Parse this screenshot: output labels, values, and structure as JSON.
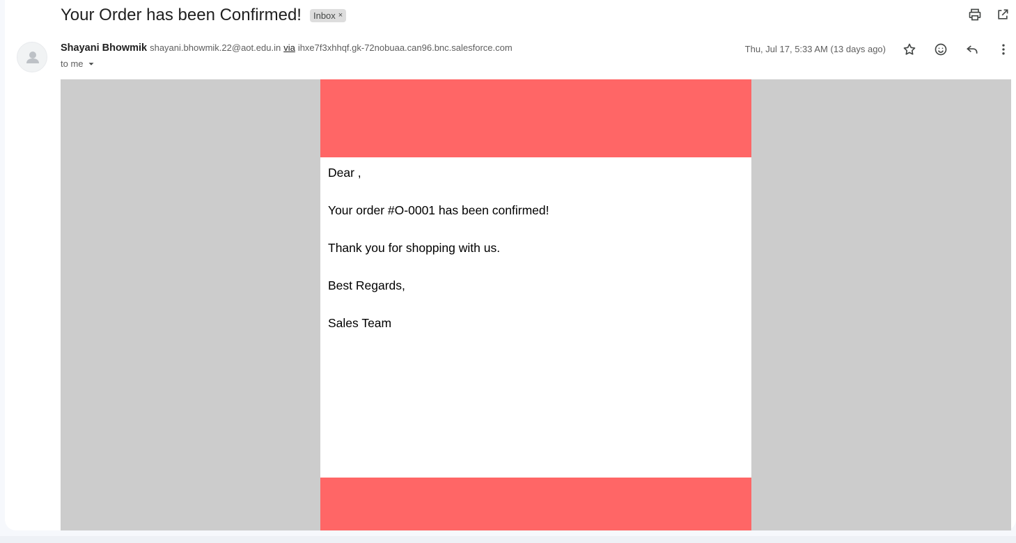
{
  "subject": "Your Order has been Confirmed!",
  "label_chip": {
    "text": "Inbox",
    "close": "×"
  },
  "sender": {
    "name": "Shayani Bhowmik",
    "email": "shayani.bhowmik.22@aot.edu.in",
    "via_label": "via",
    "via_domain": "ihxe7f3xhhqf.gk-72nobuaa.can96.bnc.salesforce.com"
  },
  "recipient": "to me",
  "date": "Thu, Jul 17, 5:33 AM (13 days ago)",
  "icons": [
    "print-icon",
    "open-in-new-window-icon",
    "star-icon",
    "emoji-reaction-icon",
    "reply-icon",
    "more-options-icon",
    "dropdown-arrow-icon",
    "avatar-person-icon"
  ],
  "message": {
    "greeting": "Dear ,",
    "line1": "Your order #O-0001 has been confirmed!",
    "line2": "Thank you for shopping with us.",
    "closing": "Best Regards,",
    "signature": "Sales Team"
  },
  "colors": {
    "banner": "#ff6666",
    "body_background": "#cccccc",
    "card": "#ffffff"
  }
}
